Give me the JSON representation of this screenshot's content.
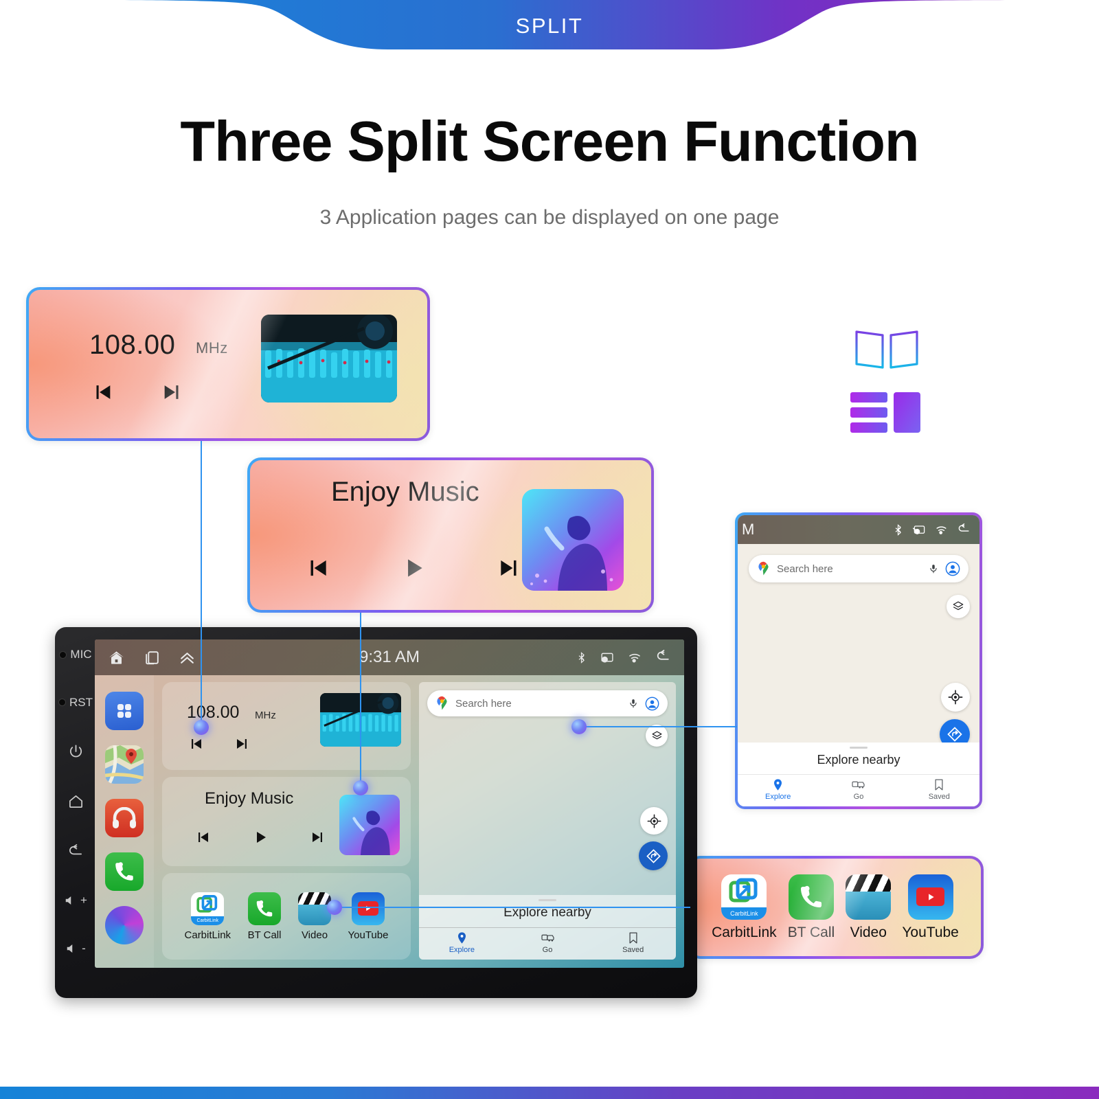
{
  "banner": {
    "label": "SPLIT"
  },
  "header": {
    "title": "Three Split Screen Function",
    "subtitle": "3 Application pages can be displayed on one page"
  },
  "colors": {
    "banner_start": "#1583d8",
    "banner_end": "#8a2bbe",
    "connector": "#2f93f0",
    "maps_accent": "#1a73e8",
    "card_border_start": "#3fa9f5",
    "card_border_end": "#b44fe0"
  },
  "radio_card": {
    "frequency": "108.00",
    "unit": "MHz",
    "prev_icon": "skip-previous-icon",
    "next_icon": "skip-next-icon",
    "thumbnail": "audio-mixer-photo"
  },
  "music_card": {
    "title": "Enjoy Music",
    "prev_icon": "skip-previous-icon",
    "play_icon": "play-icon",
    "next_icon": "skip-next-icon",
    "album_art": "singer-artwork"
  },
  "apps_card": {
    "apps": [
      {
        "label": "CarbitLink",
        "icon": "carbitlink-icon",
        "badge": "CarbitLink"
      },
      {
        "label": "BT Call",
        "icon": "phone-icon"
      },
      {
        "label": "Video",
        "icon": "clapperboard-icon"
      },
      {
        "label": "YouTube",
        "icon": "youtube-icon"
      }
    ]
  },
  "maps_card": {
    "status": {
      "left_text": "M",
      "icons": [
        "bluetooth-icon",
        "cast-icon",
        "wifi-icon",
        "back-icon"
      ]
    },
    "search": {
      "placeholder": "Search here",
      "logo_icon": "google-maps-pin-icon",
      "mic_icon": "microphone-icon",
      "account_icon": "account-circle-icon"
    },
    "fabs": [
      {
        "name": "layers-icon"
      },
      {
        "name": "my-location-icon"
      },
      {
        "name": "directions-icon"
      }
    ],
    "sheet": {
      "title": "Explore nearby",
      "nav": [
        {
          "label": "Explore",
          "icon": "place-pin-icon",
          "active": true
        },
        {
          "label": "Go",
          "icon": "commute-icon",
          "active": false
        },
        {
          "label": "Saved",
          "icon": "bookmark-icon",
          "active": false
        }
      ]
    }
  },
  "layout_icons": {
    "book": "two-panel-outline-icon",
    "split": "split-layout-filled-icon"
  },
  "head_unit": {
    "bezel": [
      {
        "label": "MIC",
        "icon": "mic-hole-icon"
      },
      {
        "label": "RST",
        "icon": "reset-hole-icon"
      },
      {
        "label": "",
        "icon": "power-icon"
      },
      {
        "label": "",
        "icon": "home-icon"
      },
      {
        "label": "",
        "icon": "back-icon"
      },
      {
        "label": "+",
        "icon": "volume-up-icon"
      },
      {
        "label": "-",
        "icon": "volume-down-icon"
      }
    ],
    "statusbar": {
      "time": "9:31 AM",
      "left_icons": [
        "home-icon",
        "recents-icon",
        "chevron-up-icon"
      ],
      "right_icons": [
        "bluetooth-icon",
        "cast-icon",
        "wifi-icon",
        "back-icon"
      ]
    },
    "dock": [
      {
        "name": "all-apps-icon"
      },
      {
        "name": "maps-icon"
      },
      {
        "name": "music-headphones-icon"
      },
      {
        "name": "phone-icon"
      },
      {
        "name": "assistant-ring-icon"
      }
    ],
    "widgets": {
      "radio": {
        "frequency": "108.00",
        "unit": "MHz"
      },
      "music": {
        "title": "Enjoy Music"
      },
      "apps": [
        {
          "label": "CarbitLink",
          "badge": "CarbitLink"
        },
        {
          "label": "BT Call"
        },
        {
          "label": "Video"
        },
        {
          "label": "YouTube"
        }
      ]
    },
    "maps": {
      "search_placeholder": "Search here",
      "sheet_title": "Explore nearby",
      "nav": [
        {
          "label": "Explore",
          "active": true
        },
        {
          "label": "Go",
          "active": false
        },
        {
          "label": "Saved",
          "active": false
        }
      ]
    }
  }
}
